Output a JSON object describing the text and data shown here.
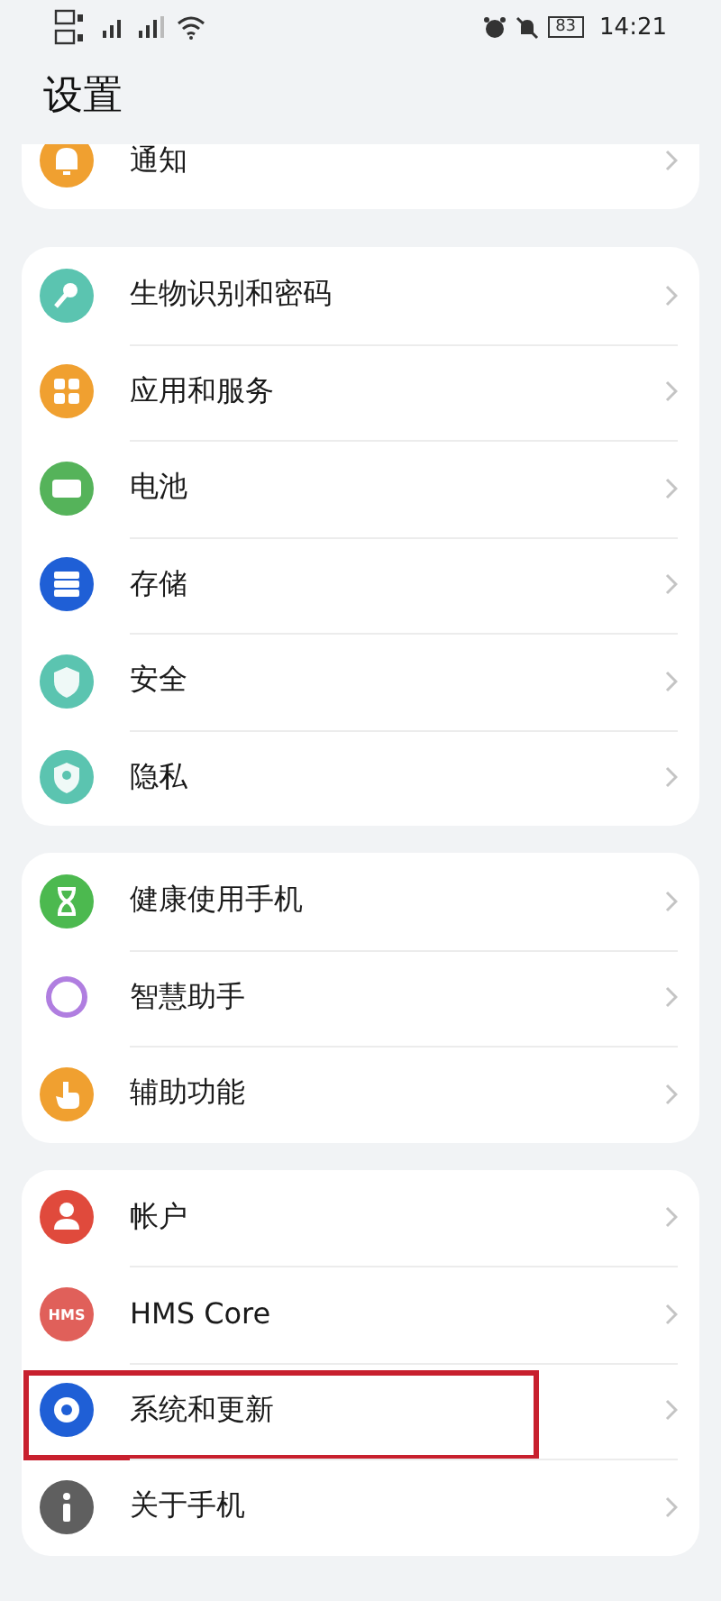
{
  "status_bar": {
    "battery": "83",
    "time": "14:21"
  },
  "title": "设置",
  "groups": [
    {
      "clipped": true,
      "items": [
        {
          "label": "通知",
          "kind": "bell",
          "color": "#f0a030",
          "highlighted": false
        }
      ]
    },
    {
      "clipped": false,
      "items": [
        {
          "label": "生物识别和密码",
          "kind": "key",
          "color": "#5bc4b0",
          "highlighted": false
        },
        {
          "label": "应用和服务",
          "kind": "grid",
          "color": "#f0a030",
          "highlighted": false
        },
        {
          "label": "电池",
          "kind": "battery",
          "color": "#55b35a",
          "highlighted": false
        },
        {
          "label": "存储",
          "kind": "storage",
          "color": "#1f5fd6",
          "highlighted": false
        },
        {
          "label": "安全",
          "kind": "shield",
          "color": "#5bc4b0",
          "highlighted": false
        },
        {
          "label": "隐私",
          "kind": "privacy",
          "color": "#5bc4b0",
          "highlighted": false
        }
      ]
    },
    {
      "clipped": false,
      "items": [
        {
          "label": "健康使用手机",
          "kind": "hourglass",
          "color": "#4cb94f",
          "highlighted": false
        },
        {
          "label": "智慧助手",
          "kind": "ring",
          "color": "#b07ee0",
          "highlighted": false
        },
        {
          "label": "辅助功能",
          "kind": "hand",
          "color": "#f0a030",
          "highlighted": false
        }
      ]
    },
    {
      "clipped": false,
      "items": [
        {
          "label": "帐户",
          "kind": "person",
          "color": "#e04a3c",
          "highlighted": false
        },
        {
          "label": "HMS Core",
          "kind": "text",
          "icon_text": "HMS",
          "color": "#e0605a",
          "highlighted": false
        },
        {
          "label": "系统和更新",
          "kind": "gear",
          "color": "#1f5fd6",
          "highlighted": true
        },
        {
          "label": "关于手机",
          "kind": "info",
          "color": "#5f5f5f",
          "highlighted": false
        }
      ]
    }
  ]
}
